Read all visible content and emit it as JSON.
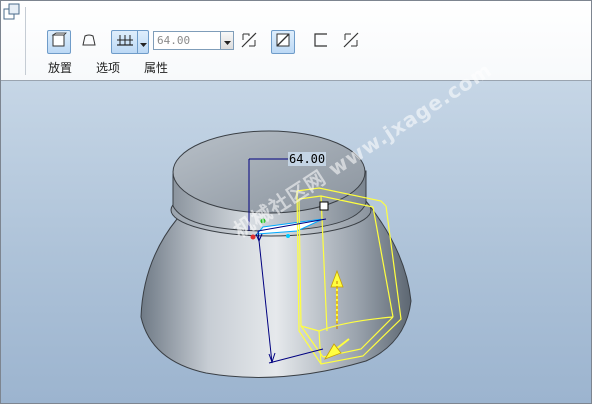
{
  "dashboard": {
    "depth_value": "64.00",
    "tabs": [
      {
        "label": "放置"
      },
      {
        "label": "选项"
      },
      {
        "label": "属性"
      }
    ]
  },
  "viewport": {
    "dimension_label": "64.00",
    "watermark": "机械社区网 www.jxage.com"
  },
  "colors": {
    "viewport_top": "#c6d6e6",
    "viewport_bottom": "#9cb4cf",
    "preview_geometry": "#ffff00",
    "dimension_line": "#000080"
  }
}
